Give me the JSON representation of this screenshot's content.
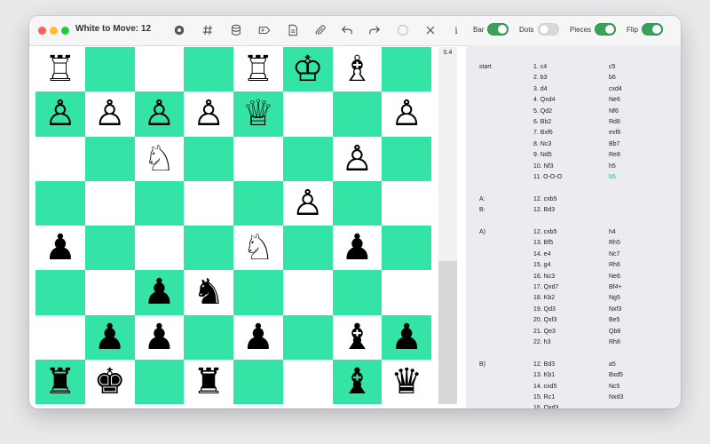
{
  "window": {
    "title": "White to Move: 12"
  },
  "toolbar": {
    "icons": [
      "settings-icon",
      "grid-icon",
      "database-icon",
      "label-icon",
      "document-icon",
      "paperclip-icon",
      "undo-icon",
      "redo-icon",
      "stop-icon",
      "close-icon",
      "info-icon"
    ],
    "info_label": "i",
    "toggles": [
      {
        "label": "Bar",
        "on": true
      },
      {
        "label": "Dots",
        "on": false
      },
      {
        "label": "Pieces",
        "on": true
      },
      {
        "label": "Flip",
        "on": true
      }
    ]
  },
  "colors": {
    "dark_square": "#34e4a6",
    "light_square": "#ffffff",
    "toggle_on": "#37a35a",
    "current_move": "#2fb37c"
  },
  "board": {
    "rows": [
      [
        "♖",
        "",
        "",
        "",
        "♖",
        "♔",
        "♗",
        ""
      ],
      [
        "♙",
        "♙",
        "♙",
        "♙",
        "♕",
        "",
        "",
        "♙"
      ],
      [
        "",
        "",
        "♘",
        "",
        "",
        "",
        "♙",
        ""
      ],
      [
        "",
        "",
        "",
        "",
        "",
        "♙",
        "",
        ""
      ],
      [
        "♟",
        "",
        "",
        "",
        "♘",
        "",
        "♟",
        ""
      ],
      [
        "",
        "",
        "♟",
        "♞",
        "",
        "",
        "",
        ""
      ],
      [
        "",
        "♟",
        "♟",
        "",
        "♟",
        "",
        "♝",
        "♟"
      ],
      [
        "♜",
        "♚",
        "",
        "♜",
        "",
        "",
        "♝",
        "♛"
      ]
    ]
  },
  "evaluation": {
    "value": "0.4",
    "fill_fraction": 0.4
  },
  "moves": {
    "lines": [
      {
        "label": "start",
        "white": "1. c4",
        "black": "c5"
      },
      {
        "label": "",
        "white": "2. b3",
        "black": "b6"
      },
      {
        "label": "",
        "white": "3. d4",
        "black": "cxd4"
      },
      {
        "label": "",
        "white": "4. Qxd4",
        "black": "Ne6"
      },
      {
        "label": "",
        "white": "5. Qd2",
        "black": "Nf6"
      },
      {
        "label": "",
        "white": "6. Bb2",
        "black": "Rd8"
      },
      {
        "label": "",
        "white": "7. Bxf6",
        "black": "exf6"
      },
      {
        "label": "",
        "white": "8. Nc3",
        "black": "Bb7"
      },
      {
        "label": "",
        "white": "9. Nd5",
        "black": "Re8"
      },
      {
        "label": "",
        "white": "10. Nf3",
        "black": "h5"
      },
      {
        "label": "",
        "white": "11. O-O-O",
        "black": "b5",
        "current": true
      },
      {
        "gap": true
      },
      {
        "label": "A:",
        "white": "12. cxb5",
        "black": ""
      },
      {
        "label": "B:",
        "white": "12. Bd3",
        "black": ""
      },
      {
        "gap": true
      },
      {
        "label": "A)",
        "white": "12. cxb5",
        "black": "h4"
      },
      {
        "label": "",
        "white": "13. Bf5",
        "black": "Rh5"
      },
      {
        "label": "",
        "white": "14. e4",
        "black": "Nc7"
      },
      {
        "label": "",
        "white": "15. g4",
        "black": "Rh6"
      },
      {
        "label": "",
        "white": "16. Nc3",
        "black": "Ne6"
      },
      {
        "label": "",
        "white": "17. Qxd7",
        "black": "Bf4+"
      },
      {
        "label": "",
        "white": "18. Kb2",
        "black": "Ng5"
      },
      {
        "label": "",
        "white": "19. Qd3",
        "black": "Nxf3"
      },
      {
        "label": "",
        "white": "20. Qxf3",
        "black": "Be5"
      },
      {
        "label": "",
        "white": "21. Qe3",
        "black": "Qb8"
      },
      {
        "label": "",
        "white": "22. h3",
        "black": "Rh8"
      },
      {
        "gap": true
      },
      {
        "label": "B)",
        "white": "12. Bd3",
        "black": "a5"
      },
      {
        "label": "",
        "white": "13. Kb1",
        "black": "Bxd5"
      },
      {
        "label": "",
        "white": "14. cxd5",
        "black": "Nc5"
      },
      {
        "label": "",
        "white": "15. Rc1",
        "black": "Nxd3"
      },
      {
        "label": "",
        "white": "16. Qxd3",
        "black": ""
      }
    ]
  }
}
